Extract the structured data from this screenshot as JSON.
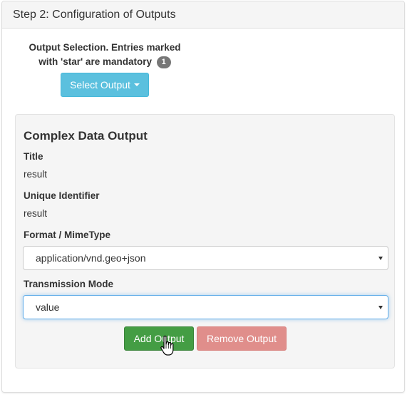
{
  "panel": {
    "heading": "Step 2: Configuration of Outputs"
  },
  "output_selection": {
    "text_line1": "Output Selection. Entries marked",
    "text_line2": "with 'star' are mandatory",
    "badge_count": "1",
    "select_button_label": "Select Output"
  },
  "output": {
    "title": "Complex Data Output",
    "fields": {
      "title_label": "Title",
      "title_value": "result",
      "identifier_label": "Unique Identifier",
      "identifier_value": "result",
      "format_label": "Format / MimeType",
      "format_value": "application/vnd.geo+json",
      "transmission_label": "Transmission Mode",
      "transmission_value": "value"
    },
    "buttons": {
      "add_label": "Add Output",
      "remove_label": "Remove Output"
    }
  },
  "colors": {
    "info_button": "#5bc0de",
    "success_button": "#449d44",
    "danger_button": "#e08e8b",
    "badge": "#777777",
    "focus_border": "#66afe9"
  },
  "icons": {
    "dropdown": "caret-down-icon",
    "cursor": "hand-pointer-icon"
  }
}
